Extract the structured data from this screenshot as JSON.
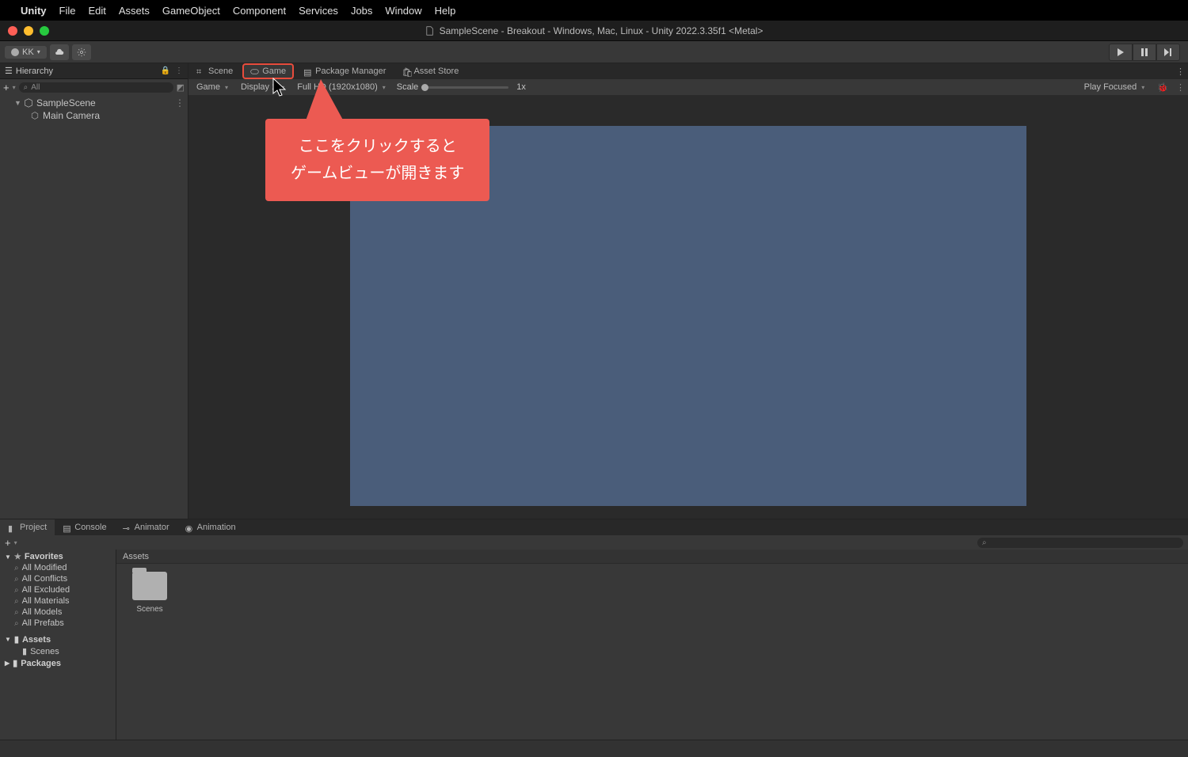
{
  "menubar": {
    "app": "Unity",
    "items": [
      "File",
      "Edit",
      "Assets",
      "GameObject",
      "Component",
      "Services",
      "Jobs",
      "Window",
      "Help"
    ]
  },
  "title": "SampleScene - Breakout - Windows, Mac, Linux - Unity 2022.3.35f1 <Metal>",
  "account": "KK",
  "hierarchy": {
    "title": "Hierarchy",
    "search_placeholder": "All",
    "scene": "SampleScene",
    "items": [
      "Main Camera"
    ]
  },
  "view_tabs": {
    "scene": "Scene",
    "game": "Game",
    "package_manager": "Package Manager",
    "asset_store": "Asset Store"
  },
  "game_toolbar": {
    "mode": "Game",
    "display": "Display 1",
    "resolution": "Full HD (1920x1080)",
    "scale_label": "Scale",
    "scale_value": "1x",
    "play_focused": "Play Focused"
  },
  "callout": {
    "line1": "ここをクリックすると",
    "line2": "ゲームビューが開きます"
  },
  "project": {
    "tabs": {
      "project": "Project",
      "console": "Console",
      "animator": "Animator",
      "animation": "Animation"
    },
    "favorites_label": "Favorites",
    "favorites": [
      "All Modified",
      "All Conflicts",
      "All Excluded",
      "All Materials",
      "All Models",
      "All Prefabs"
    ],
    "assets_label": "Assets",
    "assets_children": [
      "Scenes"
    ],
    "packages_label": "Packages",
    "breadcrumb": "Assets",
    "folder_name": "Scenes"
  }
}
